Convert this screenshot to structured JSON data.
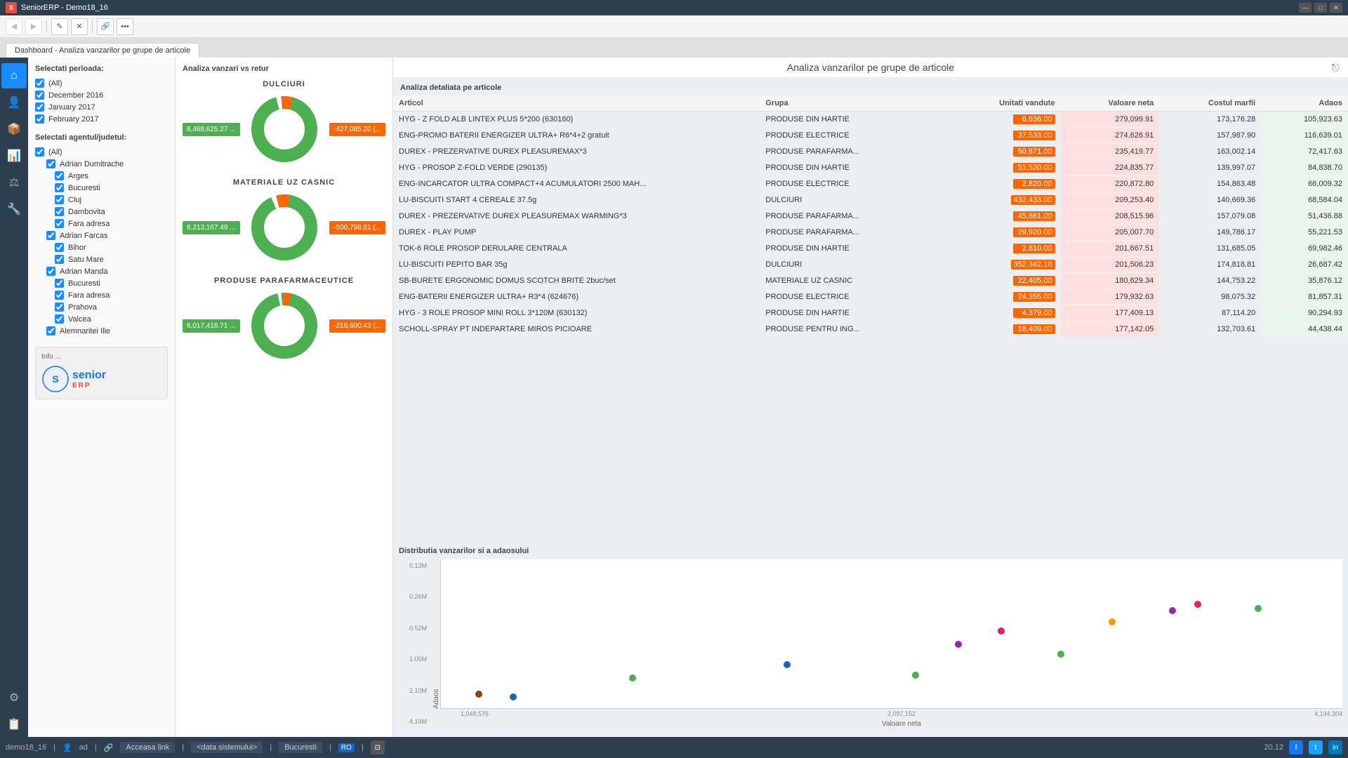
{
  "titlebar": {
    "title": "SeniorERP - Demo18_16",
    "min": "—",
    "max": "□",
    "close": "✕"
  },
  "toolbar": {
    "buttons": [
      "◀",
      "▶",
      "✎",
      "✕",
      "🔗",
      "•••"
    ]
  },
  "tab": {
    "label": "Dashboard - Analiza vanzarilor pe grupe de articole"
  },
  "page_title": "Analiza vanzarilor pe grupe de articole",
  "filter": {
    "period_label": "Selectati perioada:",
    "periods": [
      {
        "label": "(All)",
        "checked": true
      },
      {
        "label": "December 2016",
        "checked": true
      },
      {
        "label": "January 2017",
        "checked": true
      },
      {
        "label": "February 2017",
        "checked": true
      }
    ],
    "agent_label": "Selectati agentul/judetul:",
    "agents": [
      {
        "label": "(All)",
        "checked": true,
        "indent": 0
      },
      {
        "label": "Adrian Dumitrache",
        "checked": true,
        "indent": 1
      },
      {
        "label": "Arges",
        "checked": true,
        "indent": 2
      },
      {
        "label": "Bucuresti",
        "checked": true,
        "indent": 2
      },
      {
        "label": "Cluj",
        "checked": true,
        "indent": 2
      },
      {
        "label": "Dambovita",
        "checked": true,
        "indent": 2
      },
      {
        "label": "Fara adresa",
        "checked": true,
        "indent": 2
      },
      {
        "label": "Adrian Farcas",
        "checked": true,
        "indent": 1
      },
      {
        "label": "Bihor",
        "checked": true,
        "indent": 2
      },
      {
        "label": "Satu Mare",
        "checked": true,
        "indent": 2
      },
      {
        "label": "Adrian Manda",
        "checked": true,
        "indent": 1
      },
      {
        "label": "Bucuresti",
        "checked": true,
        "indent": 2
      },
      {
        "label": "Fara adresa",
        "checked": true,
        "indent": 2
      },
      {
        "label": "Prahova",
        "checked": true,
        "indent": 2
      },
      {
        "label": "Valcea",
        "checked": true,
        "indent": 2
      },
      {
        "label": "Alemnaritei Ilie",
        "checked": true,
        "indent": 1
      }
    ],
    "info_label": "Info ..."
  },
  "charts": {
    "panel_title": "Analiza vanzari vs retur",
    "donut_sections": [
      {
        "label": "DULCIURI",
        "value_left": "8,468,625.27 ...",
        "value_right": "-427,085.20 (...",
        "green_pct": 95,
        "orange_pct": 5
      },
      {
        "label": "MATERIALE UZ CASNIC",
        "value_left": "8,213,167.49 ...",
        "value_right": "-500,798.81 (...",
        "green_pct": 94,
        "orange_pct": 6
      },
      {
        "label": "PRODUSE PARAFARMACEUTICE",
        "value_left": "6,017,416.71 ...",
        "value_right": "-218,600.43 (...",
        "green_pct": 96,
        "orange_pct": 4
      }
    ]
  },
  "detail_table": {
    "title": "Analiza detaliata pe articole",
    "columns": [
      "Articol",
      "Grupa",
      "Unitati vandute",
      "Valoare neta",
      "Costul marfii",
      "Adaos"
    ],
    "rows": [
      {
        "articol": "HYG - Z FOLD ALB LINTEX PLUS 5*200 (630160)",
        "grupa": "PRODUSE DIN HARTIE",
        "unitati": "6,936.00",
        "valoare": "279,099.91",
        "cost": "173,176.28",
        "adaos": "105,923.63",
        "u_type": "orange",
        "v_type": "pink",
        "a_type": "green"
      },
      {
        "articol": "ENG-PROMO BATERII ENERGIZER ULTRA+ R6*4+2 gratuit",
        "grupa": "PRODUSE ELECTRICE",
        "unitati": "37,533.00",
        "valoare": "274,626.91",
        "cost": "157,987.90",
        "adaos": "116,639.01",
        "u_type": "orange",
        "v_type": "pink",
        "a_type": "green"
      },
      {
        "articol": "DUREX - PREZERVATIVE DUREX PLEASUREMAX*3",
        "grupa": "PRODUSE PARAFARMA...",
        "unitati": "50,871.00",
        "valoare": "235,419.77",
        "cost": "163,002.14",
        "adaos": "72,417.63",
        "u_type": "orange",
        "v_type": "pink",
        "a_type": "green"
      },
      {
        "articol": "HYG - PROSOP Z-FOLD VERDE (290135)",
        "grupa": "PRODUSE DIN HARTIE",
        "unitati": "51,520.00",
        "valoare": "224,835.77",
        "cost": "139,997.07",
        "adaos": "84,838.70",
        "u_type": "orange",
        "v_type": "pink",
        "a_type": "green"
      },
      {
        "articol": "ENG-INCARCATOR ULTRA COMPACT+4 ACUMULATORI 2500 MAH...",
        "grupa": "PRODUSE ELECTRICE",
        "unitati": "2,820.00",
        "valoare": "220,872.80",
        "cost": "154,863.48",
        "adaos": "66,009.32",
        "u_type": "orange",
        "v_type": "pink",
        "a_type": "green"
      },
      {
        "articol": "LU-BISCUITI START 4 CEREALE 37.5g",
        "grupa": "DULCIURI",
        "unitati": "432,433.00",
        "valoare": "209,253.40",
        "cost": "140,669.36",
        "adaos": "68,584.04",
        "u_type": "orange",
        "v_type": "pink",
        "a_type": "green"
      },
      {
        "articol": "DUREX - PREZERVATIVE DUREX PLEASUREMAX WARMING*3",
        "grupa": "PRODUSE PARAFARMA...",
        "unitati": "45,661.00",
        "valoare": "208,515.96",
        "cost": "157,079.08",
        "adaos": "51,436.88",
        "u_type": "orange",
        "v_type": "pink",
        "a_type": "green"
      },
      {
        "articol": "DUREX - PLAY PUMP",
        "grupa": "PRODUSE PARAFARMA...",
        "unitati": "29,920.00",
        "valoare": "205,007.70",
        "cost": "149,786.17",
        "adaos": "55,221.53",
        "u_type": "orange",
        "v_type": "pink",
        "a_type": "green"
      },
      {
        "articol": "TOK-6 ROLE PROSOP DERULARE CENTRALA",
        "grupa": "PRODUSE DIN HARTIE",
        "unitati": "2,810.00",
        "valoare": "201,667.51",
        "cost": "131,685.05",
        "adaos": "69,982.46",
        "u_type": "orange",
        "v_type": "pink",
        "a_type": "green"
      },
      {
        "articol": "LU-BISCUITI PEPITO BAR 35g",
        "grupa": "DULCIURI",
        "unitati": "352,342.18",
        "valoare": "201,506.23",
        "cost": "174,818.81",
        "adaos": "26,687.42",
        "u_type": "orange",
        "v_type": "pink",
        "a_type": "green"
      },
      {
        "articol": "SB-BURETE ERGONOMIC DOMUS SCOTCH BRITE 2buc/set",
        "grupa": "MATERIALE UZ CASNIC",
        "unitati": "22,405.00",
        "valoare": "180,629.34",
        "cost": "144,753.22",
        "adaos": "35,876.12",
        "u_type": "orange",
        "v_type": "pink",
        "a_type": "green"
      },
      {
        "articol": "ENG-BATERII ENERGIZER ULTRA+ R3*4 (624676)",
        "grupa": "PRODUSE ELECTRICE",
        "unitati": "24,355.00",
        "valoare": "179,932.63",
        "cost": "98,075.32",
        "adaos": "81,857.31",
        "u_type": "orange",
        "v_type": "pink",
        "a_type": "green"
      },
      {
        "articol": "HYG - 3 ROLE PROSOP MINI ROLL 3*120M (630132)",
        "grupa": "PRODUSE DIN HARTIE",
        "unitati": "4,379.00",
        "valoare": "177,409.13",
        "cost": "87,114.20",
        "adaos": "90,294.93",
        "u_type": "orange",
        "v_type": "pink",
        "a_type": "green"
      },
      {
        "articol": "SCHOLL-SPRAY PT INDEPARTARE MIROS PICIOARE",
        "grupa": "PRODUSE PENTRU ING...",
        "unitati": "18,409.00",
        "valoare": "177,142.05",
        "cost": "132,703.61",
        "adaos": "44,438.44",
        "u_type": "orange",
        "v_type": "pink",
        "a_type": "green"
      }
    ]
  },
  "scatter": {
    "title": "Distributia vanzarilor si a adaosului",
    "y_label": "Adaos",
    "x_label": "Valoare neta",
    "y_ticks": [
      "4.19M",
      "2.10M",
      "1.05M",
      "0.52M",
      "0.26M",
      "0.13M"
    ],
    "x_ticks": [
      "1,048,576",
      "2,097,152",
      "4,194,304"
    ],
    "dots": [
      {
        "x": 4,
        "y": 8,
        "color": "#8B4513",
        "size": 10
      },
      {
        "x": 8,
        "y": 6,
        "color": "#1565C0",
        "size": 10
      },
      {
        "x": 22,
        "y": 20,
        "color": "#4CAF50",
        "size": 10
      },
      {
        "x": 40,
        "y": 30,
        "color": "#1565C0",
        "size": 10
      },
      {
        "x": 55,
        "y": 22,
        "color": "#4CAF50",
        "size": 10
      },
      {
        "x": 60,
        "y": 45,
        "color": "#9C27B0",
        "size": 10
      },
      {
        "x": 65,
        "y": 55,
        "color": "#E91E63",
        "size": 10
      },
      {
        "x": 72,
        "y": 38,
        "color": "#4CAF50",
        "size": 10
      },
      {
        "x": 78,
        "y": 62,
        "color": "#FF9800",
        "size": 10
      },
      {
        "x": 85,
        "y": 70,
        "color": "#9C27B0",
        "size": 10
      },
      {
        "x": 88,
        "y": 75,
        "color": "#E91E63",
        "size": 10
      },
      {
        "x": 95,
        "y": 72,
        "color": "#4CAF50",
        "size": 10
      }
    ]
  },
  "statusbar": {
    "user": "demo18_16",
    "agent": "ad",
    "link_label": "Acceasa link",
    "date_placeholder": "<data sistemului>",
    "location": "Bucuresti",
    "lang": "RO",
    "time": "20.12"
  },
  "nav": {
    "items": [
      "⌂",
      "👤",
      "📦",
      "📊",
      "⚖",
      "🔧",
      "⚙",
      "📋",
      "🏠",
      "⚙",
      "📋"
    ]
  }
}
